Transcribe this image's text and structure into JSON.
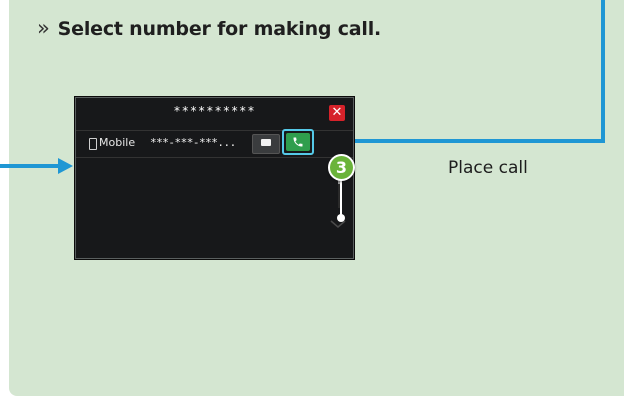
{
  "heading": {
    "chevron": "»",
    "text": "Select number for making call."
  },
  "screen": {
    "title": "**********",
    "close_icon": "close-icon",
    "contact_row": {
      "type_label": "Mobile",
      "number": "***-***-***...",
      "message_icon": "message-icon",
      "call_icon": "phone-icon"
    }
  },
  "callout": {
    "step_number": "3",
    "label": "Place call"
  },
  "colors": {
    "panel_bg": "#d4e6d1",
    "highlight_line": "#1f97d4",
    "call_button": "#2f9e4d",
    "close_button": "#d6222a",
    "step_badge": "#6ab33a"
  }
}
